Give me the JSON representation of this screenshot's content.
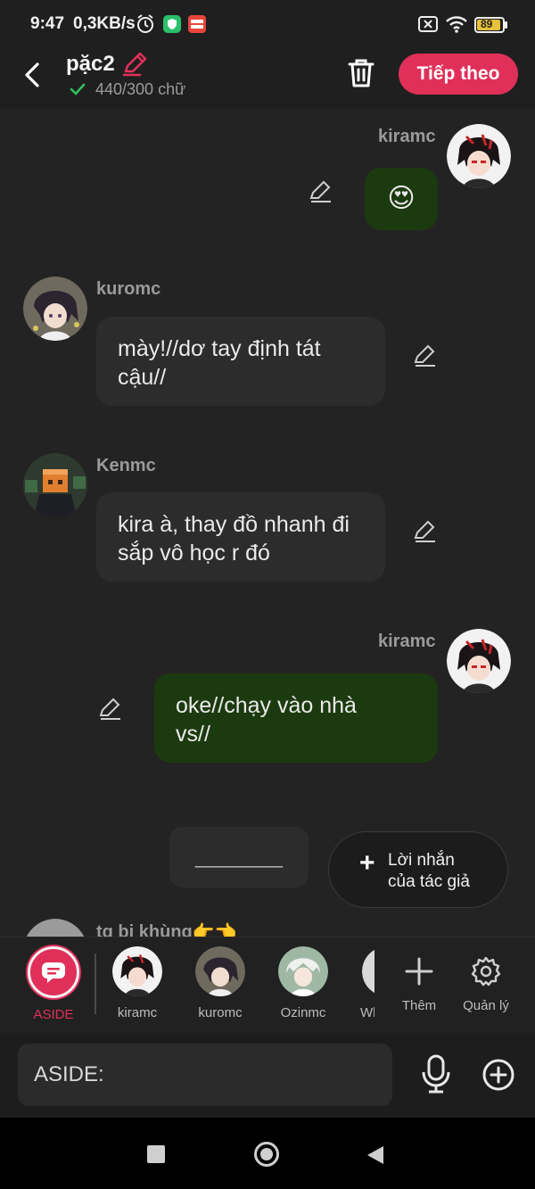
{
  "status_bar": {
    "time": "9:47",
    "speed": "0,3KB/s",
    "battery": "89"
  },
  "header": {
    "title": "pặc2",
    "word_count": "440/300 chữ",
    "next_label": "Tiếp theo"
  },
  "messages": [
    {
      "side": "right",
      "name": "kiramc",
      "text": "😍"
    },
    {
      "side": "left",
      "name": "kuromc",
      "text_lines": [
        "mày!//dơ tay định tát",
        "cậu//"
      ]
    },
    {
      "side": "left",
      "name": "Kenmc",
      "text_lines": [
        "kira à, thay đồ nhanh đi",
        "sắp vô học r đó"
      ]
    },
    {
      "side": "right",
      "name": "kiramc",
      "text_lines": [
        "oke//chạy vào nhà",
        "vs//"
      ]
    },
    {
      "side": "left",
      "name": "tg bị khùng👉👈",
      "text": ""
    }
  ],
  "blank_placeholder": "________",
  "author_note": {
    "line1": "Lời nhắn",
    "line2": "của tác giả"
  },
  "characters": [
    {
      "label": "ASIDE"
    },
    {
      "label": "kiramc"
    },
    {
      "label": "kuromc"
    },
    {
      "label": "Ozinmc"
    },
    {
      "label": "Wh"
    },
    {
      "label": "Thêm"
    },
    {
      "label": "Quản lý"
    }
  ],
  "input": {
    "prefix": "ASIDE:"
  },
  "colors": {
    "accent": "#e0305a",
    "right_bubble": "#1c3a0f",
    "left_bubble": "#2c2c2c",
    "background": "#232323"
  }
}
